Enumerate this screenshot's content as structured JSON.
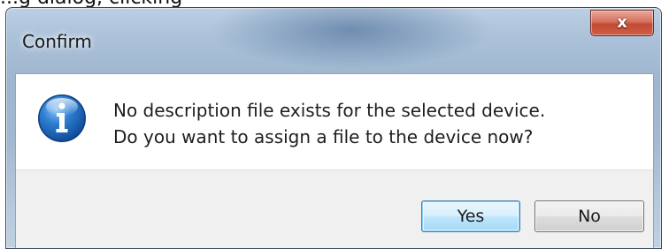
{
  "background_caption": "...g dialog, clicking",
  "dialog": {
    "title": "Confirm",
    "close_glyph": "x",
    "icon": "information-icon",
    "message_line1": "No description file exists for the selected device.",
    "message_line2": "Do you want to assign a file to the device now?",
    "buttons": {
      "yes_label": "Yes",
      "no_label": "No"
    }
  },
  "colors": {
    "info_icon_blue": "#1f6fc6",
    "close_button_red": "#c24a34",
    "default_button_border": "#3c7fb1"
  }
}
